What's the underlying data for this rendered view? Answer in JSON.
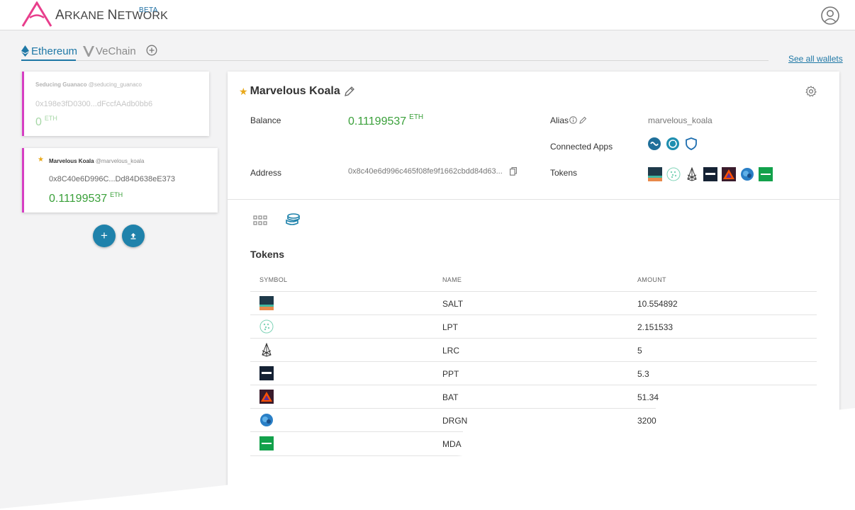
{
  "header": {
    "brand_big": "A",
    "brand_rest": "RKANE ",
    "brand_big2": "N",
    "brand_rest2": "ETWORK",
    "beta": "BETA"
  },
  "chains": {
    "tabs": [
      {
        "label": "Ethereum",
        "icon": "ethereum-icon",
        "active": true
      },
      {
        "label": "VeChain",
        "icon": "vechain-icon",
        "active": false
      }
    ],
    "see_all": "See all wallets"
  },
  "wallets": [
    {
      "name": "Seducing Guanaco",
      "handle": "@seducing_guanaco",
      "address": "0x198e3fD0300...dFccfAAdb0bb6",
      "balance": "0",
      "unit": "ETH",
      "starred": false
    },
    {
      "name": "Marvelous Koala",
      "handle": "@marvelous_koala",
      "address": "0x8C40e6D996C...Dd84D638eE373",
      "balance": "0.11199537",
      "unit": "ETH",
      "starred": true
    }
  ],
  "fab": {
    "add": "+",
    "import": "↥"
  },
  "detail": {
    "title": "Marvelous Koala",
    "balance_label": "Balance",
    "balance": "0.11199537",
    "unit": "ETH",
    "address_label": "Address",
    "address": "0x8c40e6d996c465f08fe9f1662cbdd84d63...",
    "alias_label": "Alias",
    "alias": "marvelous_koala",
    "apps_label": "Connected Apps",
    "tokens_label": "Tokens",
    "tokens_heading": "Tokens",
    "columns": [
      "SYMBOL",
      "NAME",
      "AMOUNT"
    ],
    "tokens": [
      {
        "name": "SALT",
        "amount": "10.554892"
      },
      {
        "name": "LPT",
        "amount": "2.151533"
      },
      {
        "name": "LRC",
        "amount": "5"
      },
      {
        "name": "PPT",
        "amount": "5.3"
      },
      {
        "name": "BAT",
        "amount": "51.34"
      },
      {
        "name": "DRGN",
        "amount": "3200"
      },
      {
        "name": "MDA",
        "amount": ""
      }
    ]
  },
  "colors": {
    "accent": "#1f78a6",
    "brand_pink": "#e83e8c",
    "balance_green": "#3aa03a",
    "star": "#e9a91b",
    "wallet_border": "#d63fc3"
  }
}
